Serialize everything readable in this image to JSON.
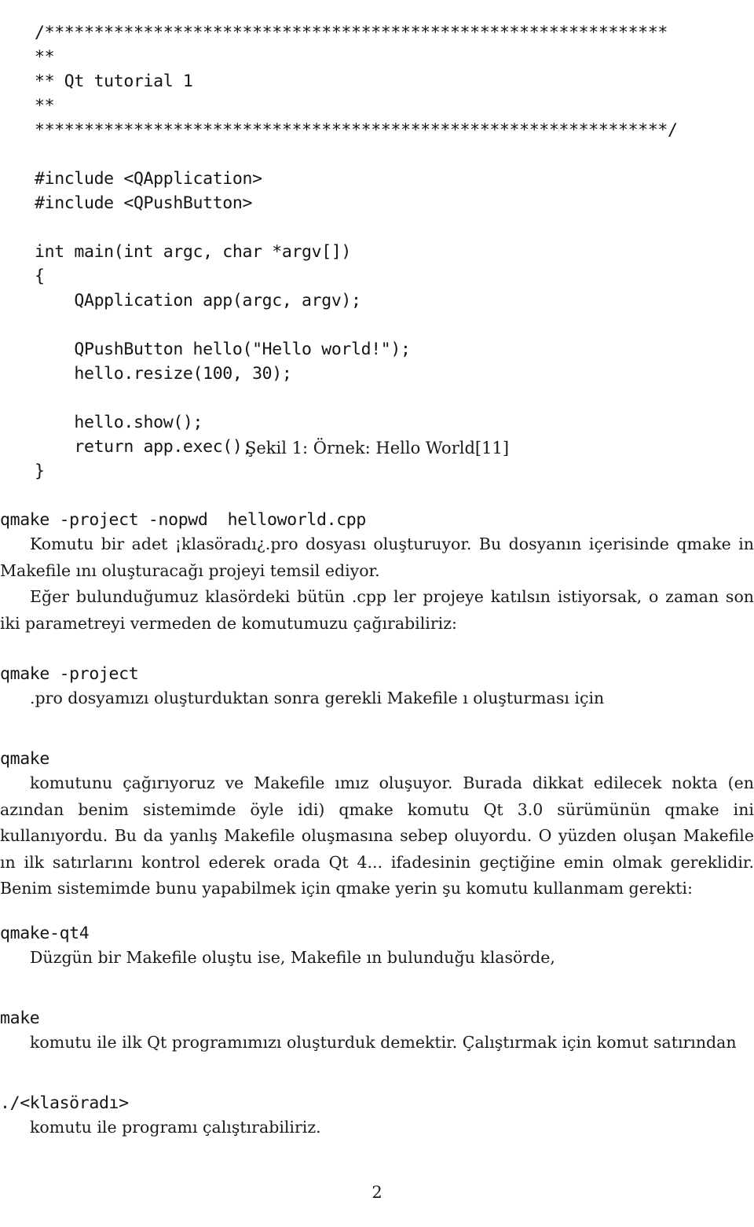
{
  "document": {
    "page_number": "2",
    "language": "tr"
  },
  "code_listing": {
    "lines": [
      "/***************************************************************",
      "**",
      "** Qt tutorial 1",
      "**",
      "****************************************************************/",
      "",
      "#include <QApplication>",
      "#include <QPushButton>",
      "",
      "int main(int argc, char *argv[])",
      "{",
      "    QApplication app(argc, argv);",
      "",
      "    QPushButton hello(\"Hello world!\");",
      "    hello.resize(100, 30);",
      "",
      "    hello.show();",
      "    return app.exec();",
      "}"
    ]
  },
  "figure_caption": "Şekil 1: Örnek: Hello World[11]",
  "commands": {
    "qmake_project_nopwd": "qmake -project -nopwd  helloworld.cpp",
    "qmake_project": "qmake -project",
    "qmake": "qmake",
    "qmake_qt4": "qmake-qt4",
    "make": "make",
    "run_program": "./<klasöradı>"
  },
  "paragraphs": {
    "p1": "Komutu bir adet ¡klasöradı¿.pro dosyası oluşturuyor. Bu dosyanın içerisinde qmake in Makefile ını oluşturacağı projeyi temsil ediyor.",
    "p2": "Eğer bulunduğumuz klasördeki bütün .cpp ler projeye katılsın istiyorsak, o zaman son iki parametreyi vermeden de komutumuzu çağırabiliriz:",
    "p3": ".pro dosyamızı oluşturduktan sonra gerekli Makefile ı oluşturması için",
    "p4": "komutunu çağırıyoruz ve Makefile ımız oluşuyor. Burada dikkat edilecek nokta (en azından benim sistemimde öyle idi) qmake komutu Qt 3.0 sürümünün qmake ini kullanıyordu. Bu da yanlış Makefile oluşmasına sebep oluyordu. O yüzden oluşan Makefile ın ilk satırlarını kontrol ederek orada Qt 4... ifadesinin geçtiğine emin olmak gereklidir. Benim sistemimde bunu yapabilmek için qmake yerin şu komutu kullanmam gerekti:",
    "p5": "Düzgün bir Makefile oluştu ise, Makefile ın bulunduğu klasörde,",
    "p6": "komutu ile ilk Qt programımızı oluşturduk demektir. Çalıştırmak için komut satırından",
    "p7": "komutu ile programı çalıştırabiliriz."
  }
}
